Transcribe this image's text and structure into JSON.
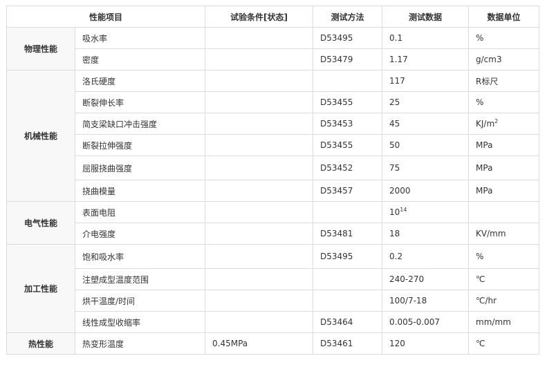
{
  "headers": [
    "性能项目",
    "试验条件[状态]",
    "测试方法",
    "测试数据",
    "数据单位"
  ],
  "groups": [
    {
      "name": "物理性能",
      "rows": [
        {
          "item": "吸水率",
          "condition": "",
          "method": "D53495",
          "value": "0.1",
          "unit": "%"
        },
        {
          "item": "密度",
          "condition": "",
          "method": "D53479",
          "value": "1.17",
          "unit": "g/cm3"
        }
      ]
    },
    {
      "name": "机械性能",
      "rows": [
        {
          "item": "洛氏硬度",
          "condition": "",
          "method": "",
          "value": "117",
          "unit": "R标尺"
        },
        {
          "item": "断裂伸长率",
          "condition": "",
          "method": "D53455",
          "value": "25",
          "unit": "%"
        },
        {
          "item": "简支梁缺口冲击强度",
          "condition": "",
          "method": "D53453",
          "value": "45",
          "unit": "KJ/m",
          "unit_sup": "2"
        },
        {
          "item": "断裂拉伸强度",
          "condition": "",
          "method": "D53455",
          "value": "50",
          "unit": "MPa"
        },
        {
          "item": "屈服挠曲强度",
          "condition": "",
          "method": "D53452",
          "value": "75",
          "unit": "MPa"
        },
        {
          "item": "挠曲模量",
          "condition": "",
          "method": "D53457",
          "value": "2000",
          "unit": "MPa"
        }
      ]
    },
    {
      "name": "电气性能",
      "rows": [
        {
          "item": "表面电阻",
          "condition": "",
          "method": "",
          "value": "10",
          "value_sup": "14",
          "unit": ""
        },
        {
          "item": "介电强度",
          "condition": "",
          "method": "D53481",
          "value": "18",
          "unit": "KV/mm"
        }
      ]
    },
    {
      "name": "加工性能",
      "rows": [
        {
          "item": "饱和吸水率",
          "condition": "",
          "method": "D53495",
          "value": "0.2",
          "unit": "%"
        },
        {
          "item": "注塑成型温度范围",
          "condition": "",
          "method": "",
          "value": "240-270",
          "unit": "℃"
        },
        {
          "item": "烘干温度/时间",
          "condition": "",
          "method": "",
          "value": "100/7-18",
          "unit": "℃/hr"
        },
        {
          "item": "线性成型收缩率",
          "condition": "",
          "method": "D53464",
          "value": "0.005-0.007",
          "unit": "mm/mm"
        }
      ]
    },
    {
      "name": "热性能",
      "rows": [
        {
          "item": "热变形温度",
          "condition": "0.45MPa",
          "method": "D53461",
          "value": "120",
          "unit": "℃"
        }
      ]
    }
  ]
}
